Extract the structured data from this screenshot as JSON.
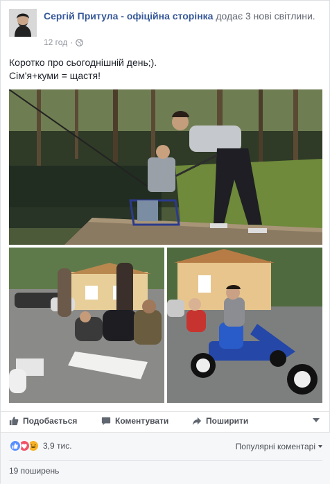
{
  "post": {
    "author": "Сергій Притула - офіційна сторінка",
    "action": " додає 3 нові світлини.",
    "time": "12 год",
    "dot": "·",
    "text_line1": "Коротко про сьогоднішній день;).",
    "text_line2": "Сім'я+куми = щастя!"
  },
  "photos": [
    {
      "name": "fishing-pier-photo"
    },
    {
      "name": "group-playing-game-photo"
    },
    {
      "name": "kids-go-kart-photo"
    }
  ],
  "actions": {
    "like_label": "Подобається",
    "comment_label": "Коментувати",
    "share_label": "Поширити"
  },
  "footer": {
    "reactions_count": "3,9 тис.",
    "sort_label": "Популярні коментарі",
    "shares_label": "19 поширень"
  },
  "colors": {
    "link": "#365899",
    "like": "#5890ff",
    "love": "#f25268",
    "haha": "#f7b125"
  },
  "icons": [
    "globe-icon",
    "thumbs-up-icon",
    "comment-icon",
    "share-arrow-icon",
    "chevron-down-icon"
  ]
}
